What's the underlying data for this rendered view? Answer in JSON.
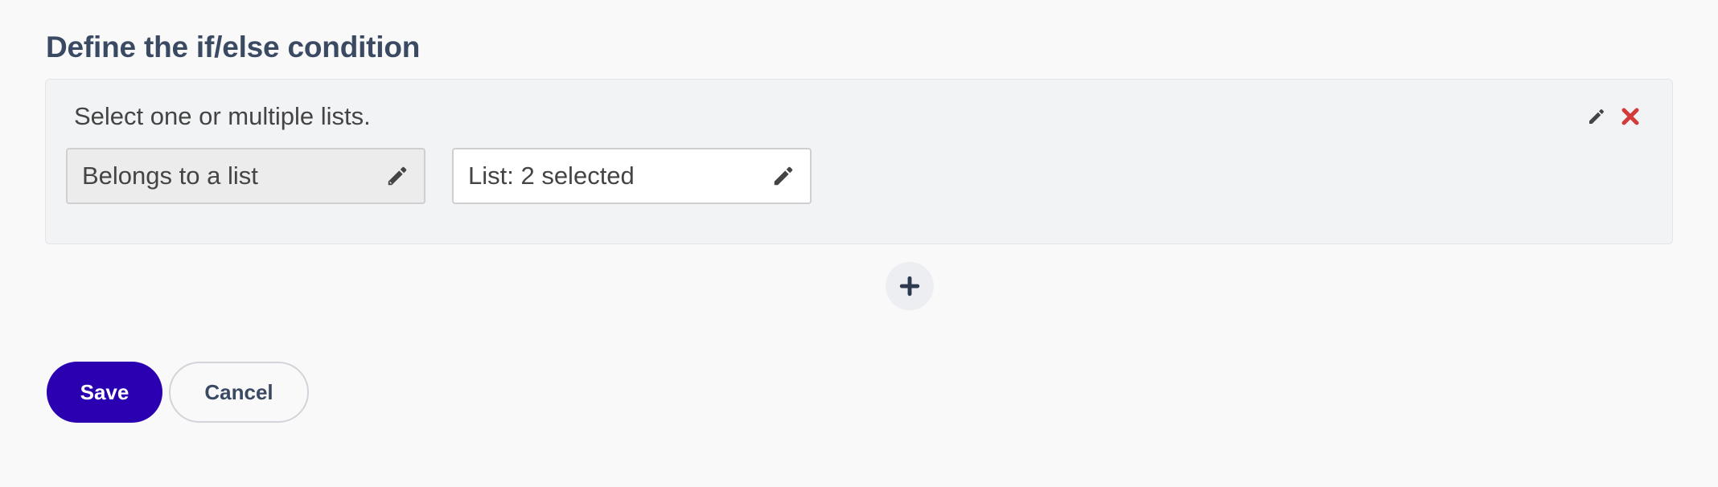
{
  "header": {
    "title": "Define the if/else condition"
  },
  "condition": {
    "hint": "Select one or multiple lists.",
    "type_field": {
      "label": "Belongs to a list",
      "icon": "pencil-icon"
    },
    "list_field": {
      "label": "List: 2 selected",
      "icon": "pencil-icon"
    },
    "actions": {
      "edit_icon": "pencil-icon",
      "delete_icon": "close-icon"
    }
  },
  "add_condition": {
    "icon": "plus-icon"
  },
  "footer": {
    "save_label": "Save",
    "cancel_label": "Cancel"
  },
  "colors": {
    "primary": "#2a00b0",
    "title": "#3b4a63",
    "danger": "#d33a3a",
    "card_bg": "#f2f3f5"
  }
}
